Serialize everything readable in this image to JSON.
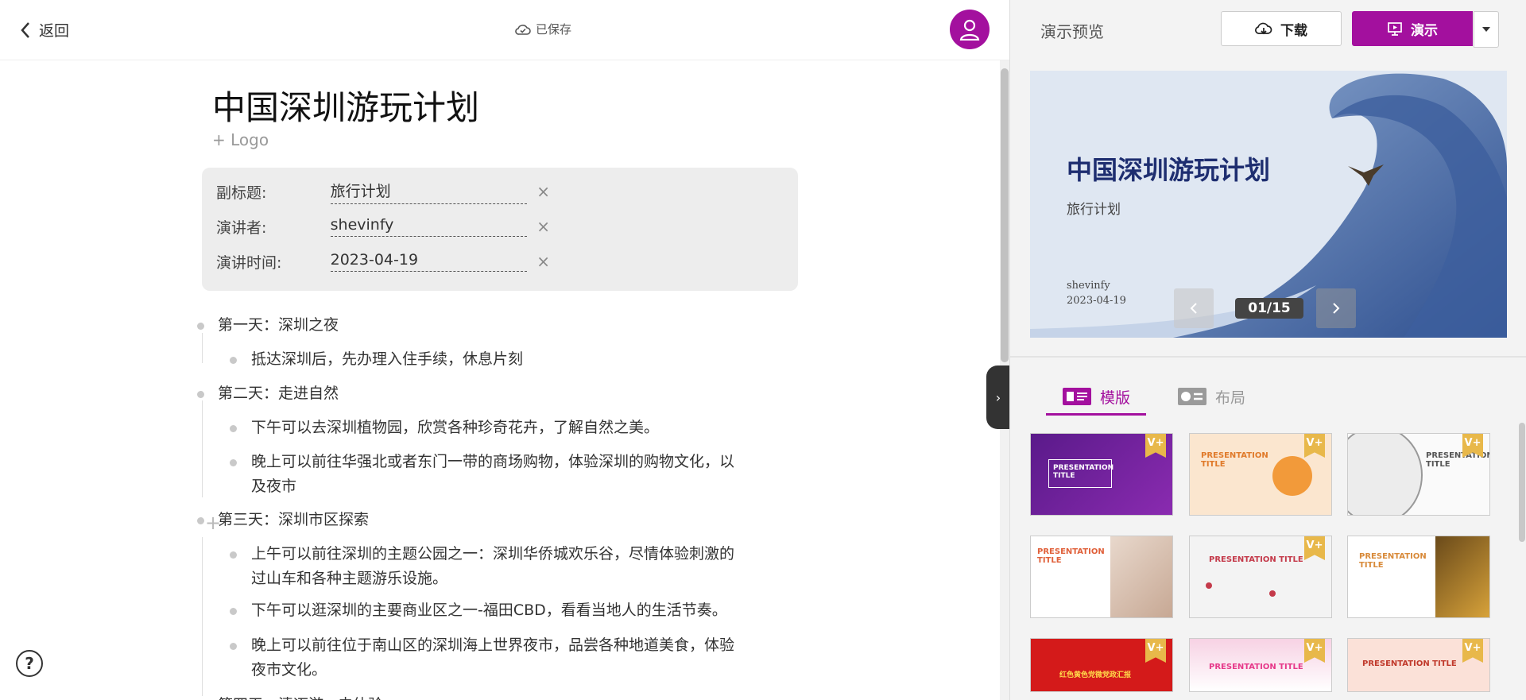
{
  "topbar": {
    "back_label": "返回",
    "saved_label": "已保存"
  },
  "document": {
    "title": "中国深圳游玩计划",
    "logo_add": "+ Logo",
    "meta": [
      {
        "label": "副标题:",
        "value": "旅行计划"
      },
      {
        "label": "演讲者:",
        "value": "shevinfy"
      },
      {
        "label": "演讲时间:",
        "value": "2023-04-19"
      }
    ],
    "remove_glyph": "×",
    "outline": {
      "day1": "第一天：深圳之夜",
      "day1_items": [
        "抵达深圳后，先办理入住手续，休息片刻"
      ],
      "day2": "第二天：走进自然",
      "day2_items": [
        "下午可以去深圳植物园，欣赏各种珍奇花卉，了解自然之美。",
        "晚上可以前往华强北或者东门一带的商场购物，体验深圳的购物文化，以",
        "及夜市"
      ],
      "day3": "第三天：深圳市区探索",
      "day3_items": [
        "上午可以前往深圳的主题公园之一：深圳华侨城欢乐谷，尽情体验刺激的",
        "过山车和各种主题游乐设施。",
        "下午可以逛深圳的主要商业区之一-福田CBD，看看当地人的生活节奏。",
        "晚上可以前往位于南山区的深圳海上世界夜市，品尝各种地道美食，体验",
        "夜市文化。"
      ],
      "day4_partial": "第四天：清迈游 · 去体验"
    },
    "plus_hint": "+",
    "help_glyph": "?"
  },
  "panel": {
    "title": "演示预览",
    "download_label": "下载",
    "present_label": "演示",
    "collapse_glyph": "›",
    "preview": {
      "title": "中国深圳游玩计划",
      "subtitle": "旅行计划",
      "author": "shevinfy",
      "date": "2023-04-19",
      "counter": "01/15"
    },
    "tabs": [
      {
        "label": "模版",
        "active": true
      },
      {
        "label": "布局",
        "active": false
      }
    ],
    "templates": [
      {
        "title": "PRESENTATION TITLE",
        "badge": "V+"
      },
      {
        "title": "PRESENTATION TITLE",
        "badge": "V+"
      },
      {
        "title": "PRESENTATION TITLE",
        "badge": "V+"
      },
      {
        "title": "PRESENTATION TITLE",
        "badge": ""
      },
      {
        "title": "PRESENTATION TITLE",
        "badge": "V+"
      },
      {
        "title": "PRESENTATION TITLE",
        "badge": ""
      },
      {
        "title": "红色黄色党微党政汇报",
        "badge": "V+"
      },
      {
        "title": "PRESENTATION TITLE",
        "badge": "V+"
      },
      {
        "title": "PRESENTATION TITLE",
        "badge": "V+"
      }
    ]
  },
  "colors": {
    "accent": "#a3109e",
    "preview_title": "#1e2e70"
  }
}
